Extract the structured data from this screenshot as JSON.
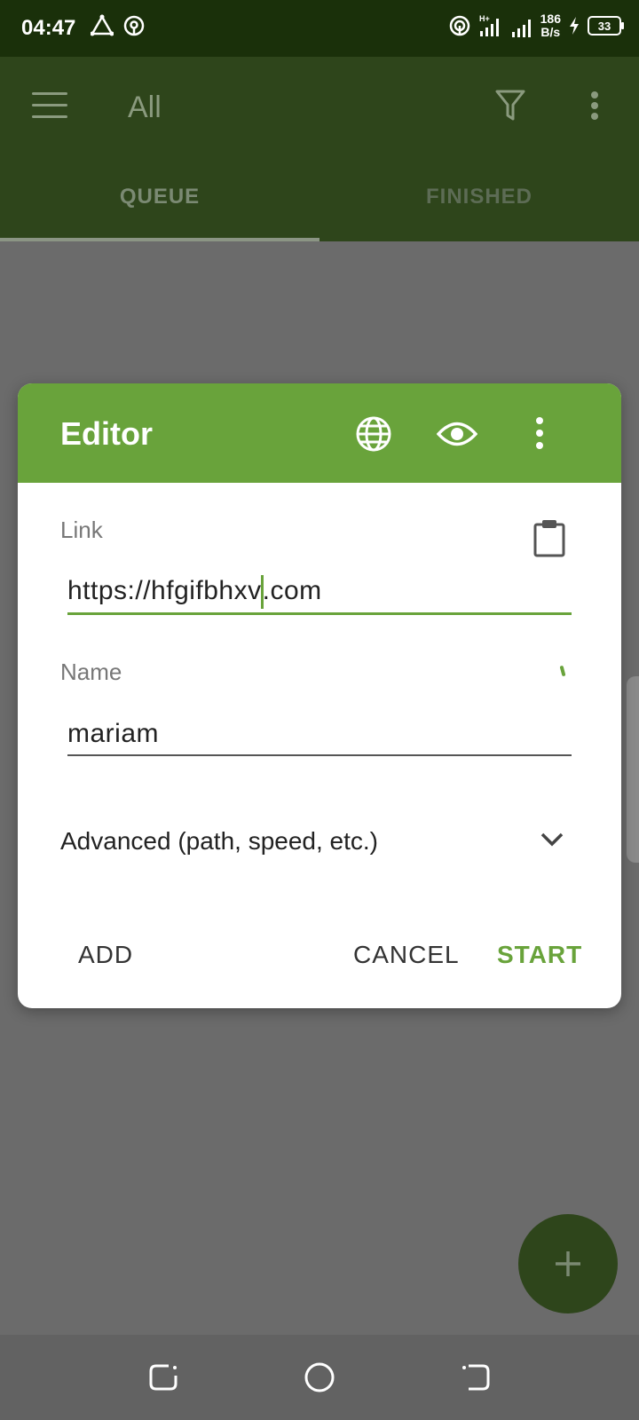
{
  "status_bar": {
    "time": "04:47",
    "net_speed_value": "186",
    "net_speed_unit": "B/s",
    "battery": "33",
    "signal_label": "H+"
  },
  "app_bar": {
    "title": "All",
    "tabs": [
      {
        "label": "QUEUE",
        "selected": true
      },
      {
        "label": "FINISHED",
        "selected": false
      }
    ]
  },
  "dialog": {
    "title": "Editor",
    "link_label": "Link",
    "link_value_before_cursor": "https://hfgifbhxv",
    "link_value_after_cursor": ".com",
    "name_label": "Name",
    "name_value": "mariam",
    "advanced_label": "Advanced (path, speed, etc.)",
    "buttons": {
      "add": "ADD",
      "cancel": "CANCEL",
      "start": "START"
    }
  },
  "colors": {
    "accent": "#69a33b",
    "app_bar_dimmed": "#2e451b",
    "status_bar": "#1a300a"
  },
  "icons": [
    "menu-icon",
    "filter-icon",
    "more-vert-icon",
    "globe-icon",
    "eye-icon",
    "clipboard-icon",
    "chevron-down-icon",
    "add-icon"
  ]
}
